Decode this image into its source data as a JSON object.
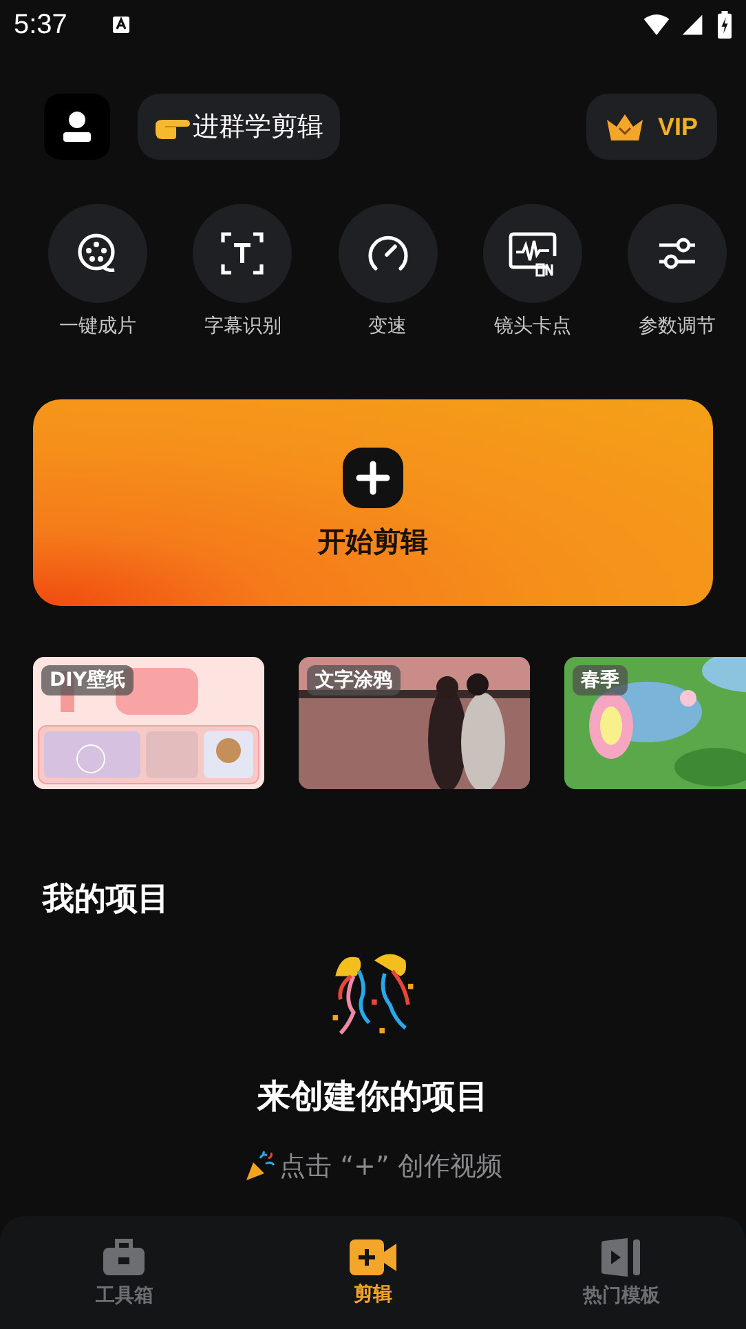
{
  "status_bar": {
    "time": "5:37"
  },
  "header": {
    "group_button": "进群学剪辑",
    "vip_button": "VIP"
  },
  "tools": [
    {
      "kind": "film",
      "label": "一键成片"
    },
    {
      "kind": "caption",
      "label": "字幕识别"
    },
    {
      "kind": "speed",
      "label": "变速"
    },
    {
      "kind": "beat",
      "label": "镜头卡点"
    },
    {
      "kind": "adjust",
      "label": "参数调节"
    }
  ],
  "start_card": {
    "label": "开始剪辑"
  },
  "templates": [
    {
      "kind": "wallpaper",
      "label": "DIY壁纸"
    },
    {
      "kind": "sunset",
      "label": "文字涂鸦"
    },
    {
      "kind": "spring",
      "label": "春季"
    }
  ],
  "projects": {
    "title": "我的项目",
    "empty_title": "来创建你的项目",
    "empty_hint": "点击 “+” 创作视频"
  },
  "nav": [
    {
      "kind": "toolbox",
      "label": "工具箱",
      "selected": false
    },
    {
      "kind": "edit",
      "label": "剪辑",
      "selected": true
    },
    {
      "kind": "templates",
      "label": "热门模板",
      "selected": false
    }
  ]
}
